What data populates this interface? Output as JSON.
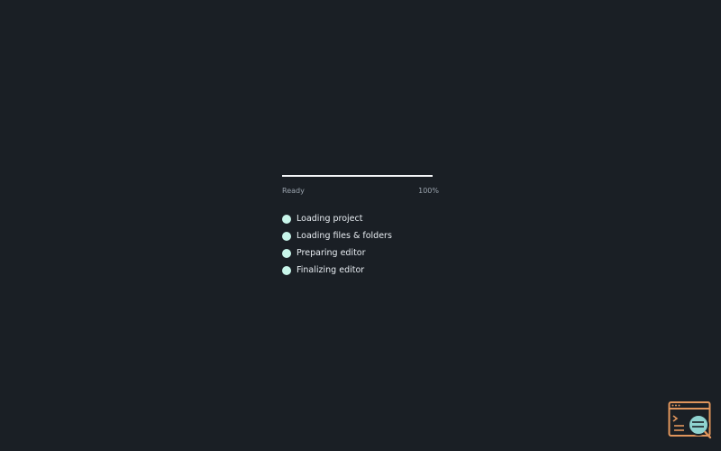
{
  "loader": {
    "progress": 100,
    "status_label": "Ready",
    "percent_label": "100%",
    "steps": [
      {
        "label": "Loading project",
        "state": "done"
      },
      {
        "label": "Loading files & folders",
        "state": "done"
      },
      {
        "label": "Preparing editor",
        "state": "done"
      },
      {
        "label": "Finalizing editor",
        "state": "done"
      }
    ]
  },
  "colors": {
    "background": "#1a1f25",
    "progress_fill": "#f4f6f8",
    "step_done": "#c8f5ea",
    "icon_accent": "#e0955c",
    "icon_secondary": "#8fd3d0"
  },
  "icons": {
    "corner": "terminal-window-search-icon"
  }
}
